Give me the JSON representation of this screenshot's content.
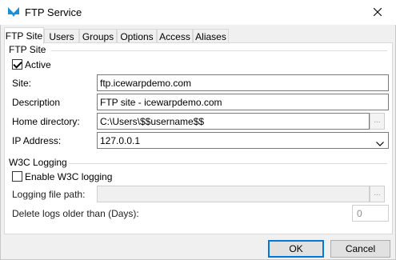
{
  "window": {
    "title": "FTP Service"
  },
  "tabs": [
    {
      "label": "FTP Site",
      "active": true
    },
    {
      "label": "Users",
      "active": false
    },
    {
      "label": "Groups",
      "active": false
    },
    {
      "label": "Options",
      "active": false
    },
    {
      "label": "Access",
      "active": false
    },
    {
      "label": "Aliases",
      "active": false
    }
  ],
  "ftp_site": {
    "group_title": "FTP Site",
    "active_label": "Active",
    "active_checked": true,
    "site_label": "Site:",
    "site_value": "ftp.icewarpdemo.com",
    "description_label": "Description",
    "description_value": "FTP site - icewarpdemo.com",
    "home_directory_label": "Home directory:",
    "home_directory_value": "C:\\Users\\$$username$$",
    "browse_label": "...",
    "ip_address_label": "IP Address:",
    "ip_address_value": "127.0.0.1"
  },
  "w3c_logging": {
    "group_title": "W3C Logging",
    "enable_label": "Enable W3C logging",
    "enable_checked": false,
    "logging_path_label": "Logging file path:",
    "logging_path_value": "",
    "browse_label": "...",
    "delete_logs_label": "Delete logs older than (Days):",
    "delete_logs_value": "0"
  },
  "buttons": {
    "ok": "OK",
    "cancel": "Cancel"
  },
  "colors": {
    "accent": "#0078d7",
    "app_icon": "#1e90d6"
  }
}
